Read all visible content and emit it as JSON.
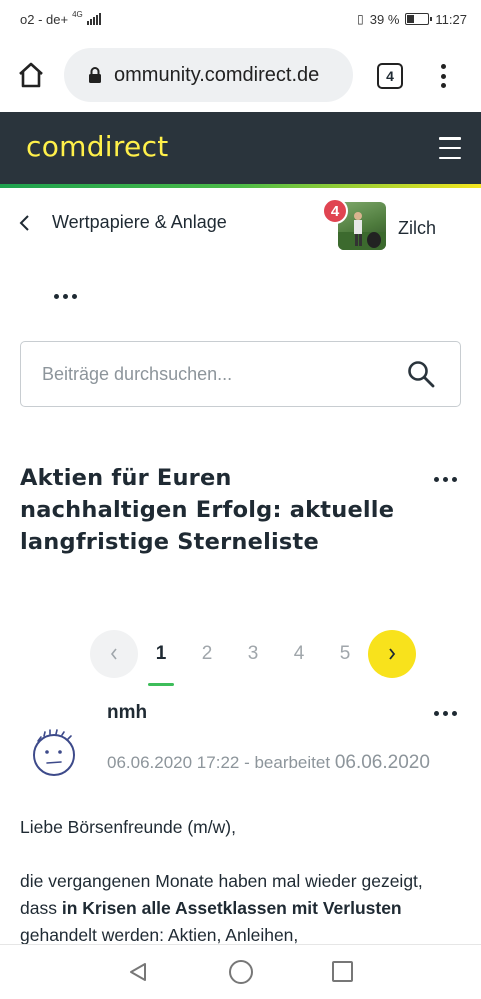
{
  "status_bar": {
    "carrier": "o2 - de+",
    "network": "4G",
    "battery": "39 %",
    "battery_level": 0.39,
    "time": "11:27"
  },
  "browser": {
    "url": "ommunity.comdirect.de",
    "tab_count": "4"
  },
  "site": {
    "logo": "comdirect",
    "colors": {
      "header_bg": "#2a343c",
      "logo": "#fff04a",
      "accent_yellow": "#f8e21c",
      "accent_green": "#3dbd5a",
      "badge_red": "#e04451"
    }
  },
  "breadcrumb": {
    "label": "Wertpapiere & Anlage"
  },
  "user": {
    "notification_count": "4",
    "name": "Zilch"
  },
  "search": {
    "placeholder": "Beiträge durchsuchen..."
  },
  "thread": {
    "title": "Aktien für Euren nachhaltigen Erfolg: aktuelle langfristige Sterneliste"
  },
  "pagination": {
    "pages": [
      "1",
      "2",
      "3",
      "4",
      "5"
    ],
    "current": "1"
  },
  "post": {
    "author": "nmh",
    "date": "06.06.2020 17:22 - bearbeitet",
    "edited_date": "06.06.2020",
    "greeting": "Liebe Börsenfreunde (m/w),",
    "p2_start": "die vergangenen Monate haben mal wieder gezeigt, dass",
    "p2_bold": "in Krisen alle Assetklassen mit Verlusten",
    "p2_end": "gehandelt werden: Aktien, Anleihen,"
  }
}
